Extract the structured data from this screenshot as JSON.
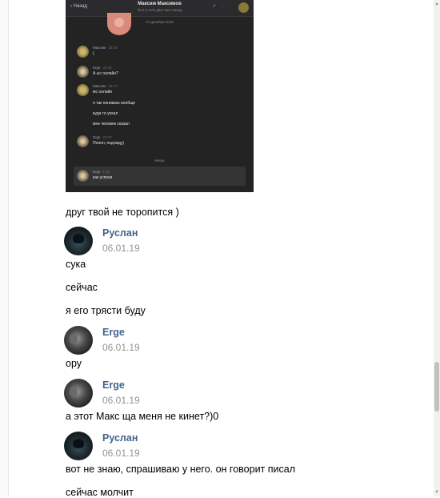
{
  "screenshot": {
    "back": "Назад",
    "title": "Максим Максимов",
    "subtitle": "был в сети два часа назад",
    "date": "27 декабря 2018",
    "messages": [
      {
        "author": "Максим",
        "time": "23:44",
        "lines": [
          "("
        ]
      },
      {
        "author": "Erge",
        "time": "23:45",
        "lines": [
          "А ыс онлайн?"
        ]
      },
      {
        "author": "Максим",
        "time": "23:47",
        "lines": [
          "мс онлайн",
          "я так понимаю вообще",
          "куда то уехал",
          "мне человек сказал"
        ]
      },
      {
        "author": "Erge",
        "time": "23:47",
        "lines": [
          "Понял, подожду)"
        ]
      }
    ],
    "divider": "вчера",
    "last_message": {
      "author": "Erge",
      "time": "1:30",
      "lines": [
        "как успехи"
      ]
    }
  },
  "chat": {
    "intro_text": "друг твой не торопится )",
    "groups": [
      {
        "author": "Руслан",
        "date": "06.01.19",
        "avatar": "ruslan",
        "messages": [
          "сука",
          "сейчас",
          "я его трясти буду"
        ]
      },
      {
        "author": "Erge",
        "date": "06.01.19",
        "avatar": "erge",
        "messages": [
          "ору"
        ]
      },
      {
        "author": "Erge",
        "date": "06.01.19",
        "avatar": "erge",
        "messages": [
          "а этот Макс ща меня не кинет?)0"
        ]
      },
      {
        "author": "Руслан",
        "date": "06.01.19",
        "avatar": "ruslan",
        "messages": [
          "вот не знаю, спрашиваю у него. он говорит писал",
          "сейчас молчит"
        ]
      }
    ]
  },
  "icons": {
    "scroll_up": "scroll-up-arrow-icon",
    "scroll_down": "scroll-down-arrow-icon"
  },
  "colors": {
    "author_link": "#42648b",
    "date_text": "#939393",
    "dark_theme_bg": "#232324"
  }
}
